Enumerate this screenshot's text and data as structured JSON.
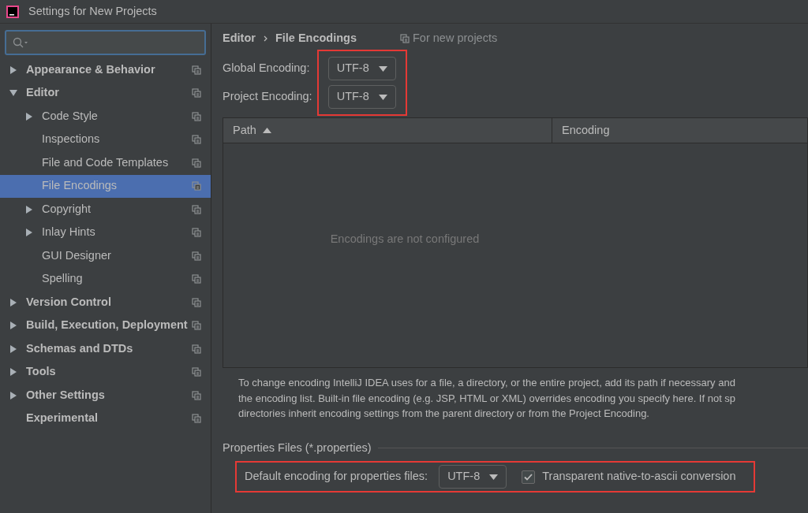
{
  "window": {
    "title": "Settings for New Projects"
  },
  "sidebar": {
    "items": [
      {
        "label": "Appearance & Behavior",
        "expanded": false,
        "has_children": true,
        "selected": false
      },
      {
        "label": "Editor",
        "expanded": true,
        "has_children": true,
        "selected": false,
        "children": [
          {
            "label": "Code Style",
            "has_children": true,
            "expanded": false,
            "selected": false
          },
          {
            "label": "Inspections",
            "has_children": false,
            "selected": false
          },
          {
            "label": "File and Code Templates",
            "has_children": false,
            "selected": false
          },
          {
            "label": "File Encodings",
            "has_children": false,
            "selected": true
          },
          {
            "label": "Copyright",
            "has_children": true,
            "expanded": false,
            "selected": false
          },
          {
            "label": "Inlay Hints",
            "has_children": true,
            "expanded": false,
            "selected": false
          },
          {
            "label": "GUI Designer",
            "has_children": false,
            "selected": false
          },
          {
            "label": "Spelling",
            "has_children": false,
            "selected": false
          }
        ]
      },
      {
        "label": "Version Control",
        "expanded": false,
        "has_children": true,
        "selected": false
      },
      {
        "label": "Build, Execution, Deployment",
        "expanded": false,
        "has_children": true,
        "selected": false
      },
      {
        "label": "Schemas and DTDs",
        "expanded": false,
        "has_children": true,
        "selected": false
      },
      {
        "label": "Tools",
        "expanded": false,
        "has_children": true,
        "selected": false
      },
      {
        "label": "Other Settings",
        "expanded": false,
        "has_children": true,
        "selected": false
      },
      {
        "label": "Experimental",
        "has_children": false,
        "selected": false
      }
    ]
  },
  "breadcrumb": [
    "Editor",
    "File Encodings"
  ],
  "scope_note": "For new projects",
  "encodings": {
    "highlighted": true,
    "fields": [
      {
        "label": "Global Encoding:",
        "value": "UTF-8"
      },
      {
        "label": "Project Encoding:",
        "value": "UTF-8"
      }
    ]
  },
  "table": {
    "columns": [
      {
        "label": "Path",
        "sorted": true
      },
      {
        "label": "Encoding",
        "sorted": false
      }
    ],
    "empty_text": "Encodings are not configured"
  },
  "description": [
    "To change encoding IntelliJ IDEA uses for a file, a directory, or the entire project, add its path if necessary and",
    "the encoding list. Built-in file encoding (e.g. JSP, HTML or XML) overrides encoding you specify here. If not sp",
    "directories inherit encoding settings from the parent directory or from the Project Encoding."
  ],
  "properties": {
    "title": "Properties Files (*.properties)",
    "highlighted": true,
    "label": "Default encoding for properties files:",
    "value": "UTF-8",
    "checkbox": {
      "label": "Transparent native-to-ascii conversion",
      "checked": true
    }
  }
}
